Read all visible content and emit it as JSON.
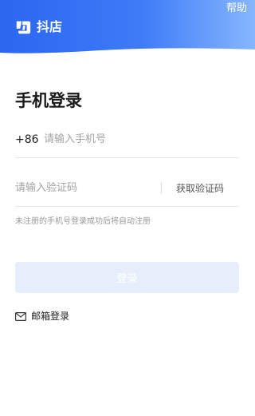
{
  "header": {
    "brand_name": "抖店",
    "logo_icon": "doudian-logo-icon",
    "help_label": "帮助",
    "gradient_start": "#2f6df6",
    "gradient_end": "#7fb0ff"
  },
  "login": {
    "title": "手机登录",
    "country_code": "+86",
    "phone_placeholder": "请输入手机号",
    "code_placeholder": "请输入验证码",
    "get_code_label": "获取验证码",
    "notice": "未注册的手机号登录成功后将自动注册",
    "submit_label": "登录",
    "submit_bg": "#e6eefb",
    "email_icon": "mail-icon",
    "email_login_label": "邮箱登录"
  }
}
